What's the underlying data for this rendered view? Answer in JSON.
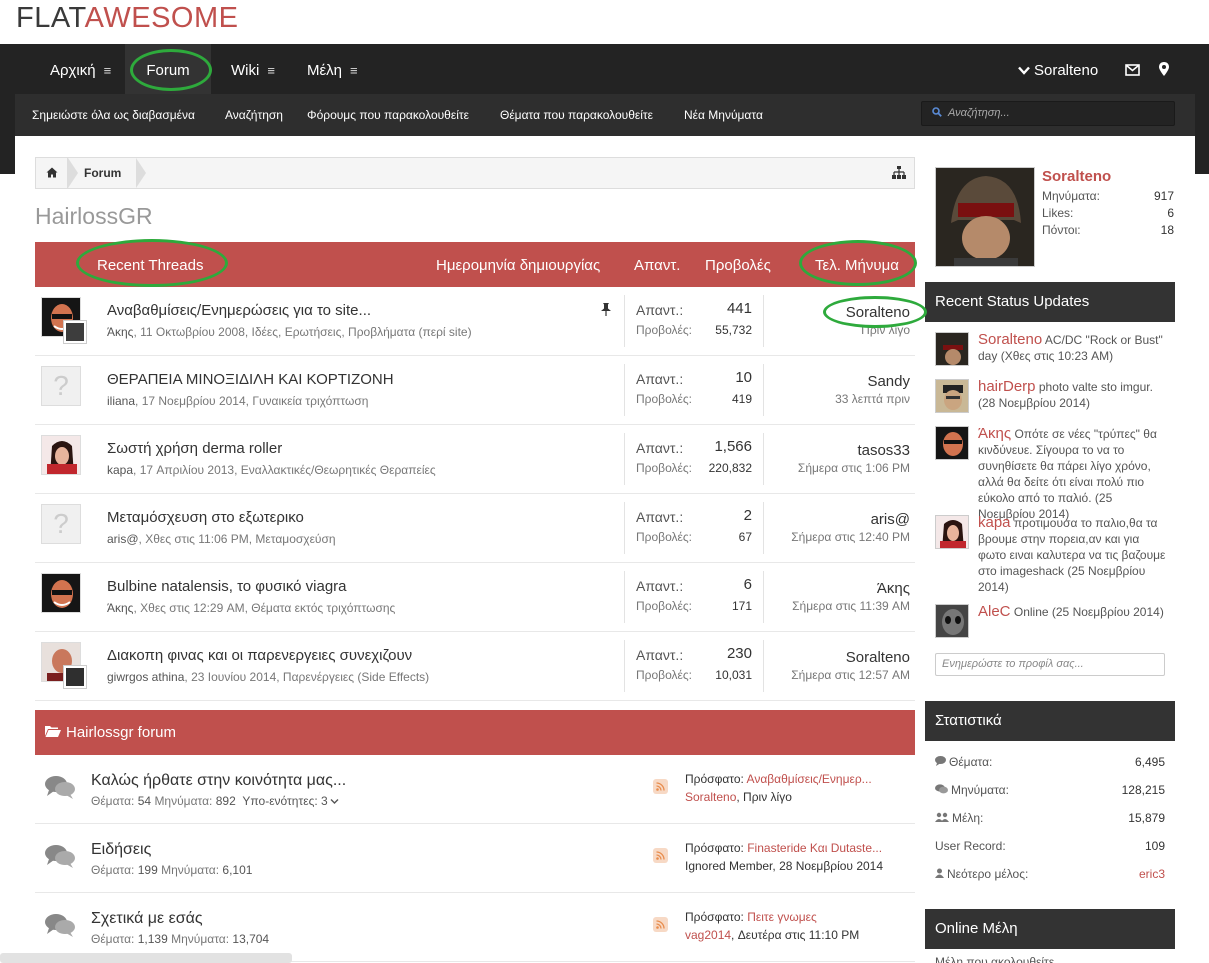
{
  "logo": {
    "part1": "FLAT",
    "part2": "AWESOME"
  },
  "nav": {
    "items": [
      {
        "label": "Αρχική",
        "menu_icon": "≡"
      },
      {
        "label": "Forum",
        "menu_icon": ""
      },
      {
        "label": "Wiki",
        "menu_icon": "≡"
      },
      {
        "label": "Μέλη",
        "menu_icon": "≡"
      }
    ],
    "user": "Soralteno"
  },
  "subnav": {
    "items": [
      "Σημειώστε όλα ως διαβασμένα",
      "Αναζήτηση",
      "Φόρουμς που παρακολουθείτε",
      "Θέματα που παρακολουθείτε",
      "Νέα Μηνύματα"
    ],
    "search_placeholder": "Αναζήτηση..."
  },
  "breadcrumb": {
    "forum": "Forum"
  },
  "page_title": "HairlossGR",
  "threads_header": {
    "title": "Recent Threads",
    "created": "Ημερομηνία δημιουργίας",
    "replies": "Απαντ.",
    "views": "Προβολές",
    "last": "Τελ. Μήνυμα"
  },
  "threads": [
    {
      "title": "Αναβαθμίσεις/Ενημερώσεις για το site...",
      "author": "Άκης",
      "date": "11 Οκτωβρίου 2008",
      "forum": "Ιδέες, Ερωτήσεις, Προβλήματα (περί site)",
      "replies_label": "Απαντ.:",
      "replies": "441",
      "views_label": "Προβολές:",
      "views": "55,732",
      "last_user": "Soralteno",
      "last_time": "Πριν λίγο",
      "pinned": true
    },
    {
      "title": "ΘΕΡΑΠΕΙΑ ΜΙΝΟΞΙΔΙΛΗ ΚΑΙ ΚΟΡΤΙΖΟΝΗ",
      "author": "iliana",
      "date": "17 Νοεμβρίου 2014",
      "forum": "Γυναικεία τριχόπτωση",
      "replies_label": "Απαντ.:",
      "replies": "10",
      "views_label": "Προβολές:",
      "views": "419",
      "last_user": "Sandy",
      "last_time": "33 λεπτά πριν",
      "pinned": false
    },
    {
      "title": "Σωστή χρήση derma roller",
      "author": "kapa",
      "date": "17 Απριλίου 2013",
      "forum": "Εναλλακτικές/Θεωρητικές Θεραπείες",
      "replies_label": "Απαντ.:",
      "replies": "1,566",
      "views_label": "Προβολές:",
      "views": "220,832",
      "last_user": "tasos33",
      "last_time": "Σήμερα στις 1:06 PM",
      "pinned": false
    },
    {
      "title": "Μεταμόσχευση στο εξωτερικο",
      "author": "aris@",
      "date": "Χθες στις 11:06 PM",
      "forum": "Μεταμοσχεύση",
      "replies_label": "Απαντ.:",
      "replies": "2",
      "views_label": "Προβολές:",
      "views": "67",
      "last_user": "aris@",
      "last_time": "Σήμερα στις 12:40 PM",
      "pinned": false
    },
    {
      "title": "Bulbine natalensis, το φυσικό viagra",
      "author": "Άκης",
      "date": "Χθες στις 12:29 AM",
      "forum": "Θέματα εκτός τριχόπτωσης",
      "replies_label": "Απαντ.:",
      "replies": "6",
      "views_label": "Προβολές:",
      "views": "171",
      "last_user": "Άκης",
      "last_time": "Σήμερα στις 11:39 AM",
      "pinned": false
    },
    {
      "title": "Διακοπη φινας και οι παρενεργειες συνεχιζουν",
      "author": "giwrgos athina",
      "date": "23 Ιουνίου 2014",
      "forum": "Παρενέργειες (Side Effects)",
      "replies_label": "Απαντ.:",
      "replies": "230",
      "views_label": "Προβολές:",
      "views": "10,031",
      "last_user": "Soralteno",
      "last_time": "Σήμερα στις 12:57 AM",
      "pinned": false
    }
  ],
  "forum_section": {
    "title": "Hairlossgr forum"
  },
  "forums": [
    {
      "title": "Καλώς ήρθατε στην κοινότητα μας...",
      "threads_label": "Θέματα:",
      "threads": "54",
      "posts_label": "Μηνύματα:",
      "posts": "892",
      "sub_label": "Υπο-ενότητες:",
      "sub": "3",
      "recent_label": "Πρόσφατο:",
      "recent_title": "Αναβαθμίσεις/Ενημερ...",
      "recent_user": "Soralteno",
      "recent_time": "Πριν λίγο"
    },
    {
      "title": "Ειδήσεις",
      "threads_label": "Θέματα:",
      "threads": "199",
      "posts_label": "Μηνύματα:",
      "posts": "6,101",
      "sub_label": "",
      "sub": "",
      "recent_label": "Πρόσφατο:",
      "recent_title": "Finasteride Και Dutaste...",
      "recent_user": "Ignored Member",
      "recent_time": "28 Νοεμβρίου 2014"
    },
    {
      "title": "Σχετικά με εσάς",
      "threads_label": "Θέματα:",
      "threads": "1,139",
      "posts_label": "Μηνύματα:",
      "posts": "13,704",
      "sub_label": "",
      "sub": "",
      "recent_label": "Πρόσφατο:",
      "recent_title": "Πειτε γνωμες",
      "recent_user": "vag2014",
      "recent_time": "Δευτέρα στις 11:10 PM"
    }
  ],
  "profile": {
    "name": "Soralteno",
    "messages_label": "Μηνύματα:",
    "messages": "917",
    "likes_label": "Likes:",
    "likes": "6",
    "points_label": "Πόντοι:",
    "points": "18"
  },
  "status_updates": {
    "title": "Recent Status Updates",
    "items": [
      {
        "user": "Soralteno",
        "text": "AC/DC \"Rock or Bust\" day",
        "time": "(Χθες στις 10:23 AM)"
      },
      {
        "user": "hairDerp",
        "text": "photo valte sto imgur.",
        "time": "(28 Νοεμβρίου 2014)"
      },
      {
        "user": "Άκης",
        "text": "Οπότε σε νέες \"τρύπες\" θα κινδύνευε. Σίγουρα το να το συνηθίσετε θα πάρει λίγο χρόνο, αλλά θα δείτε ότι είναι πολύ πιο εύκολο από το παλιό.",
        "time": "(25 Νοεμβρίου 2014)"
      },
      {
        "user": "kapa",
        "text": "προτιμουσα το παλιο,θα τα βρουμε στην πορεια,αν και για φωτο ειναι καλυτερα να τις βαζουμε στο imageshack",
        "time": "(25 Νοεμβρίου 2014)"
      },
      {
        "user": "AleC",
        "text": "Online",
        "time": "(25 Νοεμβρίου 2014)"
      }
    ],
    "input_placeholder": "Ενημερώστε το προφίλ σας..."
  },
  "statistics": {
    "title": "Στατιστικά",
    "rows": [
      {
        "label": "Θέματα:",
        "value": "6,495",
        "icon": "comment-icon"
      },
      {
        "label": "Μηνύματα:",
        "value": "128,215",
        "icon": "comments-icon"
      },
      {
        "label": "Μέλη:",
        "value": "15,879",
        "icon": "users-icon"
      },
      {
        "label": "User Record:",
        "value": "109",
        "icon": ""
      },
      {
        "label": "Νεότερο μέλος:",
        "value": "eric3",
        "icon": "user-icon"
      }
    ]
  },
  "online": {
    "title": "Online Μέλη",
    "subtitle": "Μέλη που ακολουθείτε"
  },
  "colors": {
    "accent": "#c0504d",
    "nav": "#232323",
    "annotation": "#2eaa3c"
  }
}
